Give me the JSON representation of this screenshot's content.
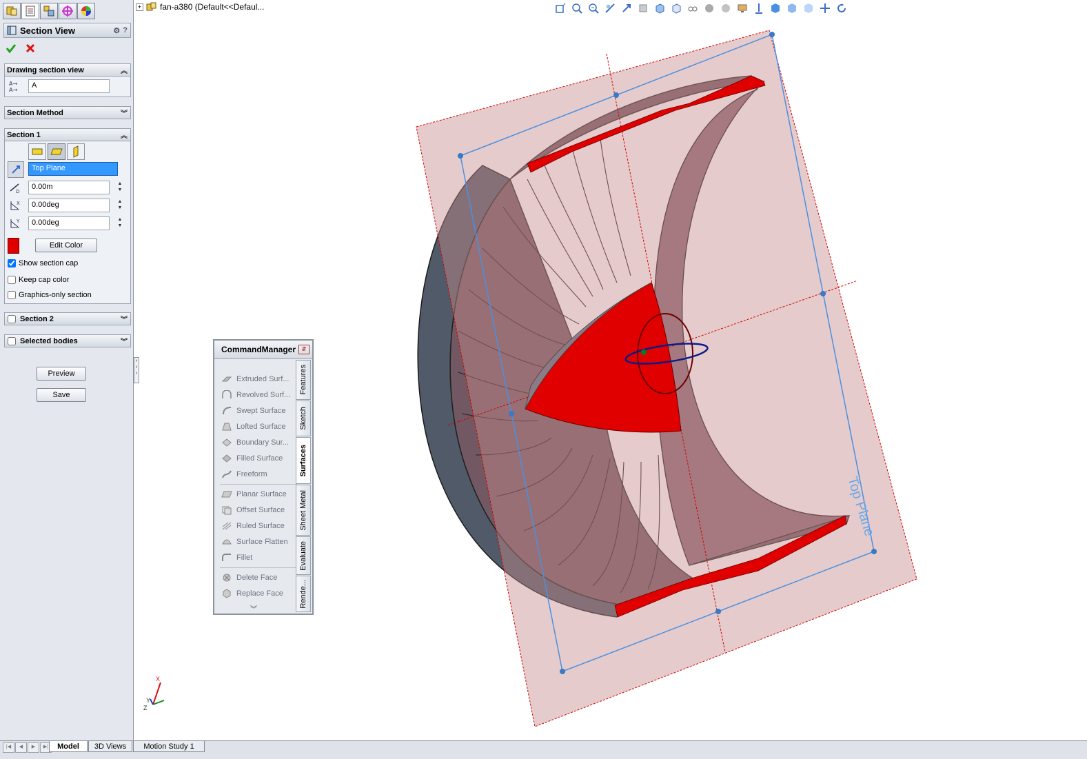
{
  "document": {
    "tree_label": "fan-a380  (Default<<Defaul..."
  },
  "property_manager": {
    "tabs": [
      "feature-manager",
      "property-manager",
      "configuration-manager",
      "dimxpert-manager",
      "display-manager"
    ],
    "title": "Section View",
    "drawing_section_view": {
      "header": "Drawing section view",
      "label_value": "A"
    },
    "section_method": {
      "header": "Section Method"
    },
    "section1": {
      "header": "Section 1",
      "plane_value": "Top Plane",
      "offset_value": "0.00m",
      "rot_x_value": "0.00deg",
      "rot_y_value": "0.00deg",
      "cap_color": "#e00000",
      "edit_color_label": "Edit Color",
      "show_section_cap": {
        "label": "Show section cap",
        "checked": true
      },
      "keep_cap_color": {
        "label": "Keep cap color",
        "checked": false
      },
      "graphics_only": {
        "label": "Graphics-only section",
        "checked": false
      }
    },
    "section2": {
      "header": "Section 2"
    },
    "selected_bodies": {
      "header": "Selected bodies"
    },
    "preview_label": "Preview",
    "save_label": "Save"
  },
  "command_manager": {
    "title": "CommandManager",
    "items": [
      "Extruded Surf...",
      "Revolved Surf...",
      "Swept Surface",
      "Lofted Surface",
      "Boundary Sur...",
      "Filled Surface",
      "Freeform",
      "Planar Surface",
      "Offset Surface",
      "Ruled Surface",
      "Surface Flatten",
      "Fillet",
      "Delete Face",
      "Replace Face"
    ],
    "tabs": [
      "Features",
      "Sketch",
      "Surfaces",
      "Sheet Metal",
      "Evaluate",
      "Rende..."
    ],
    "active_tab": "Surfaces"
  },
  "viewport": {
    "plane_label": "Top Plane",
    "triad": {
      "x": "X",
      "y": "Y",
      "z": "Z"
    },
    "colors": {
      "section_cap": "#e00000",
      "plane_fill": "#c58b8b",
      "plane_boundary": "#4a90e2",
      "body": "#5e4650"
    }
  },
  "bottom_tabs": [
    "Model",
    "3D Views",
    "Motion Study 1"
  ],
  "active_bottom_tab": "Model"
}
